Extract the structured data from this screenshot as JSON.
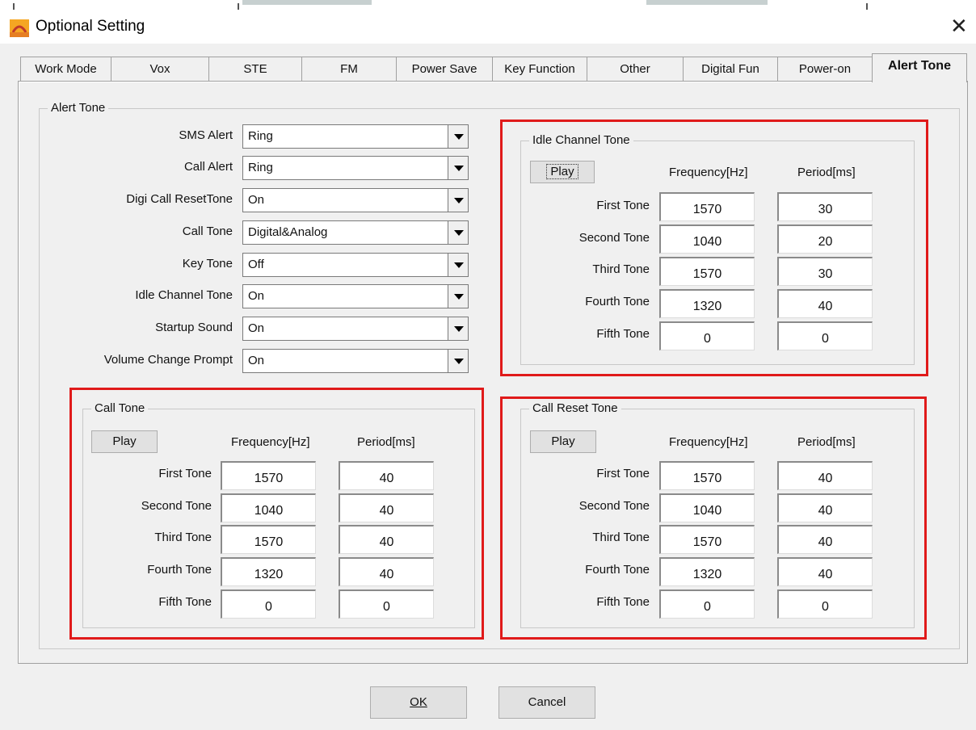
{
  "window": {
    "title": "Optional Setting"
  },
  "tabs": [
    "Work Mode",
    "Vox",
    "STE",
    "FM",
    "Power Save",
    "Key Function",
    "Other",
    "Digital Fun",
    "Power-on",
    "Alert Tone"
  ],
  "alert_tone": {
    "group_title": "Alert Tone",
    "settings": [
      {
        "label": "SMS Alert",
        "value": "Ring"
      },
      {
        "label": "Call Alert",
        "value": "Ring"
      },
      {
        "label": "Digi Call ResetTone",
        "value": "On"
      },
      {
        "label": "Call Tone",
        "value": "Digital&Analog"
      },
      {
        "label": "Key Tone",
        "value": "Off"
      },
      {
        "label": "Idle Channel Tone",
        "value": "On"
      },
      {
        "label": "Startup Sound",
        "value": "On"
      },
      {
        "label": "Volume Change Prompt",
        "value": "On"
      }
    ]
  },
  "idle_channel_tone": {
    "title": "Idle Channel Tone",
    "play_label": "Play",
    "freq_header": "Frequency[Hz]",
    "period_header": "Period[ms]",
    "rows": [
      {
        "label": "First Tone",
        "freq": "1570",
        "period": "30"
      },
      {
        "label": "Second Tone",
        "freq": "1040",
        "period": "20"
      },
      {
        "label": "Third Tone",
        "freq": "1570",
        "period": "30"
      },
      {
        "label": "Fourth Tone",
        "freq": "1320",
        "period": "40"
      },
      {
        "label": "Fifth Tone",
        "freq": "0",
        "period": "0"
      }
    ]
  },
  "call_tone": {
    "title": "Call Tone",
    "play_label": "Play",
    "freq_header": "Frequency[Hz]",
    "period_header": "Period[ms]",
    "rows": [
      {
        "label": "First Tone",
        "freq": "1570",
        "period": "40"
      },
      {
        "label": "Second Tone",
        "freq": "1040",
        "period": "40"
      },
      {
        "label": "Third Tone",
        "freq": "1570",
        "period": "40"
      },
      {
        "label": "Fourth Tone",
        "freq": "1320",
        "period": "40"
      },
      {
        "label": "Fifth Tone",
        "freq": "0",
        "period": "0"
      }
    ]
  },
  "call_reset_tone": {
    "title": "Call Reset Tone",
    "play_label": "Play",
    "freq_header": "Frequency[Hz]",
    "period_header": "Period[ms]",
    "rows": [
      {
        "label": "First Tone",
        "freq": "1570",
        "period": "40"
      },
      {
        "label": "Second Tone",
        "freq": "1040",
        "period": "40"
      },
      {
        "label": "Third Tone",
        "freq": "1570",
        "period": "40"
      },
      {
        "label": "Fourth Tone",
        "freq": "1320",
        "period": "40"
      },
      {
        "label": "Fifth Tone",
        "freq": "0",
        "period": "0"
      }
    ]
  },
  "buttons": {
    "ok": "OK",
    "cancel": "Cancel"
  },
  "colors": {
    "highlight": "#e01a1a",
    "window_bg": "#f0f0f0"
  }
}
